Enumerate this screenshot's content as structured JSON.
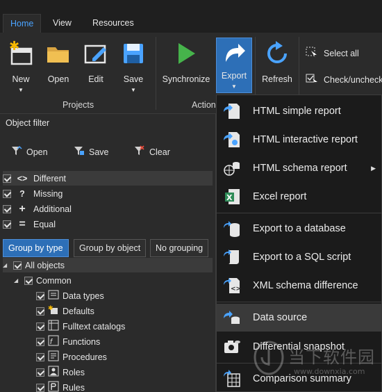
{
  "tabs": [
    "Home",
    "View",
    "Resources"
  ],
  "ribbon": {
    "new_label": "New",
    "open_label": "Open",
    "edit_label": "Edit",
    "save_label": "Save",
    "projects_group": "Projects",
    "sync_label": "Synchronize",
    "export_label": "Export",
    "refresh_label": "Refresh",
    "action_group": "Action",
    "select_all": "Select all",
    "check_uncheck": "Check/uncheck"
  },
  "filter": {
    "title": "Object filter",
    "open": "Open",
    "save": "Save",
    "clear": "Clear",
    "items": [
      "Different",
      "Missing",
      "Additional",
      "Equal"
    ]
  },
  "grouping": [
    "Group by type",
    "Group by object",
    "No grouping"
  ],
  "tree": {
    "root": "All objects",
    "common": "Common",
    "children": [
      "Data types",
      "Defaults",
      "Fulltext catalogs",
      "Functions",
      "Procedures",
      "Roles",
      "Rules"
    ]
  },
  "menu": {
    "items": [
      "HTML simple report",
      "HTML interactive report",
      "HTML schema report",
      "Excel report",
      "Export to a database",
      "Export to a SQL script",
      "XML schema difference",
      "Data source",
      "Differential snapshot",
      "Comparison summary"
    ]
  },
  "watermark": {
    "text": "当下软件园",
    "url": "www.downxia.com"
  },
  "colors": {
    "accent": "#2d6fb7",
    "tab_active": "#4aa3ff",
    "background": "#2b2b2b",
    "menu": "#1b1b1b"
  }
}
